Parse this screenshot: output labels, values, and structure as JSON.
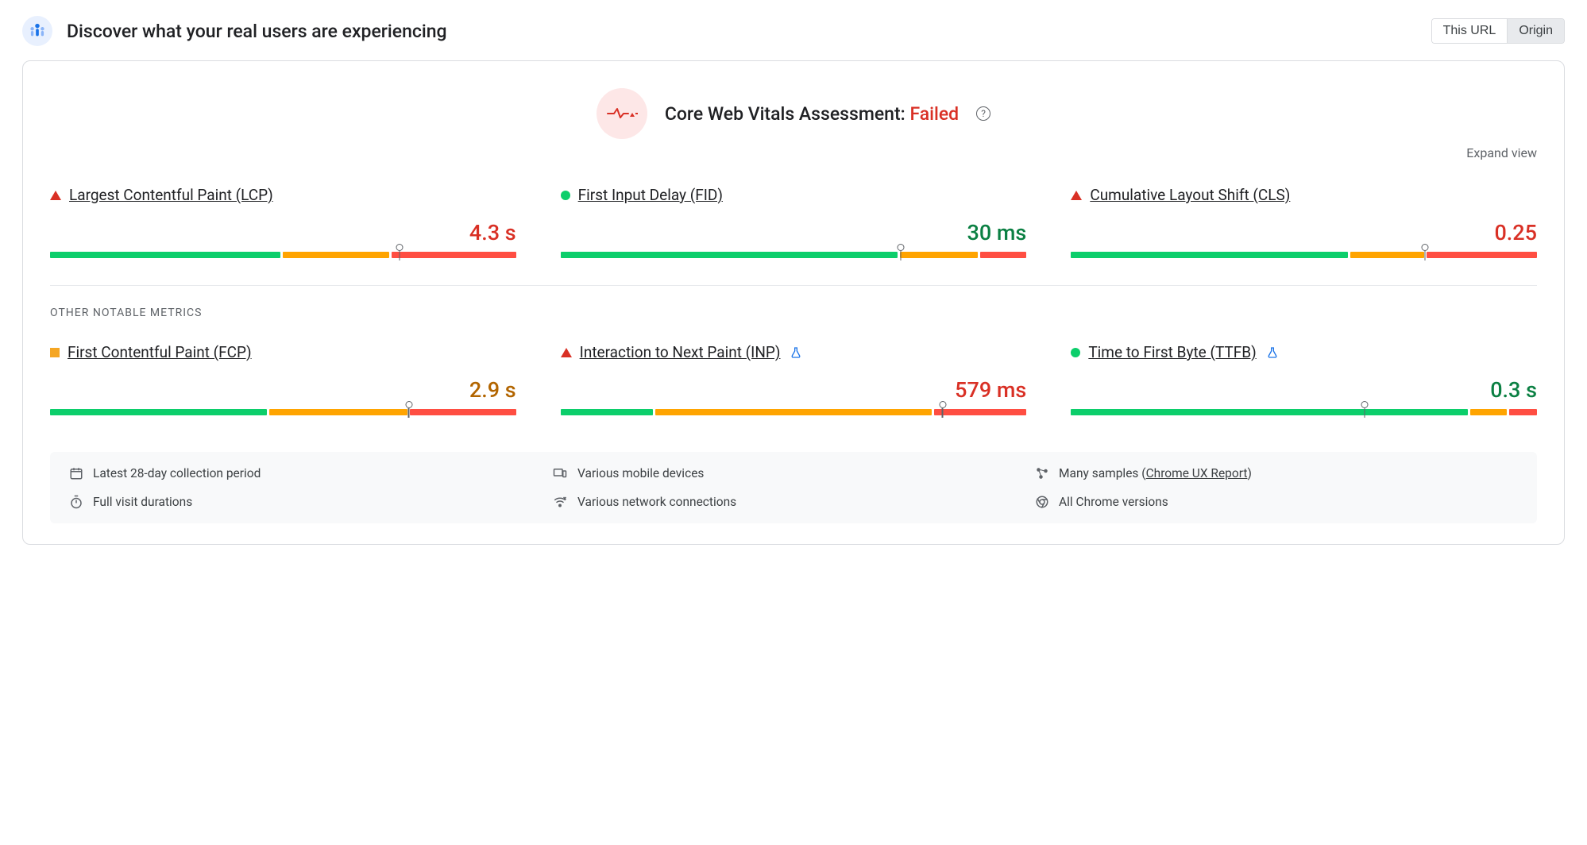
{
  "header": {
    "title": "Discover what your real users are experiencing",
    "toggle": {
      "this_url": "This URL",
      "origin": "Origin",
      "active": "origin"
    }
  },
  "assessment": {
    "label": "Core Web Vitals Assessment:",
    "status_text": "Failed",
    "status_color": "#d93025"
  },
  "expand_label": "Expand view",
  "section_other": "OTHER NOTABLE METRICS",
  "colors": {
    "good": "#0cce6b",
    "ok": "#ffa400",
    "bad": "#ff4e42"
  },
  "metrics_core": [
    {
      "name": "Largest Contentful Paint (LCP)",
      "status": "bad",
      "value": "4.3 s",
      "value_color": "red",
      "segments": [
        50,
        23,
        27
      ],
      "pin_pct": 75
    },
    {
      "name": "First Input Delay (FID)",
      "status": "good",
      "value": "30 ms",
      "value_color": "green",
      "segments": [
        73,
        17,
        10
      ],
      "pin_pct": 73
    },
    {
      "name": "Cumulative Layout Shift (CLS)",
      "status": "bad",
      "value": "0.25",
      "value_color": "red",
      "segments": [
        60,
        16,
        24
      ],
      "pin_pct": 76
    }
  ],
  "metrics_other": [
    {
      "name": "First Contentful Paint (FCP)",
      "status": "ok",
      "value": "2.9 s",
      "value_color": "orange",
      "segments": [
        47,
        30,
        23
      ],
      "pin_pct": 77,
      "experimental": false
    },
    {
      "name": "Interaction to Next Paint (INP)",
      "status": "bad",
      "value": "579 ms",
      "value_color": "red",
      "segments": [
        20,
        60,
        20
      ],
      "pin_pct": 82,
      "experimental": true
    },
    {
      "name": "Time to First Byte (TTFB)",
      "status": "good",
      "value": "0.3 s",
      "value_color": "green",
      "segments": [
        86,
        8,
        6
      ],
      "pin_pct": 63,
      "experimental": true
    }
  ],
  "footer": {
    "items": [
      {
        "icon": "calendar",
        "text": "Latest 28-day collection period"
      },
      {
        "icon": "devices",
        "text": "Various mobile devices"
      },
      {
        "icon": "samples",
        "text": "Many samples ",
        "link": "Chrome UX Report",
        "text_after": ")",
        "text_prefix_paren": "("
      },
      {
        "icon": "timer",
        "text": "Full visit durations"
      },
      {
        "icon": "network",
        "text": "Various network connections"
      },
      {
        "icon": "chrome",
        "text": "All Chrome versions"
      }
    ]
  }
}
